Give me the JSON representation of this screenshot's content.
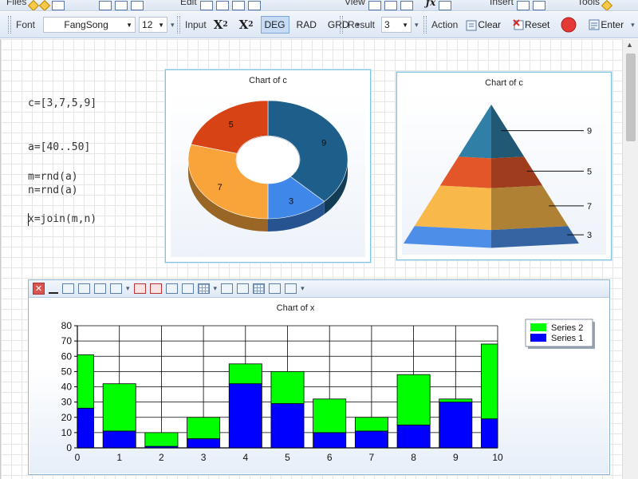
{
  "toolbar_top": {
    "files_label": "Files",
    "edit_label": "Edit",
    "view_label": "View",
    "insert_label": "Insert",
    "tools_label": "Tools"
  },
  "toolbar": {
    "font_label": "Font",
    "font_value": "FangSong",
    "size_value": "12",
    "input_label": "Input",
    "deg_label": "DEG",
    "rad_label": "RAD",
    "grd_label": "GRD",
    "result_label": "Result",
    "result_value": "3",
    "action_label": "Action",
    "clear_label": "Clear",
    "reset_label": "Reset",
    "enter_label": "Enter"
  },
  "code": {
    "line1": "c=[3,7,5,9]",
    "line2": "a=[40..50]",
    "line3": "m=rnd(a)",
    "line4": "n=rnd(a)",
    "line5": "x=join(m,n)"
  },
  "colors": {
    "toolbar_bg": "#dde7f4",
    "panel_border": "#7fc3df",
    "deg_active": "#c7dcf4",
    "series1": "#0000ff",
    "series2": "#00ff00",
    "donut_blue": "#1d5f8a",
    "donut_lightblue": "#3f87e8",
    "donut_orange": "#f9a43b",
    "donut_red": "#d84315"
  },
  "chart_data": [
    {
      "type": "pie",
      "title": "Chart of c",
      "style": "donut-3d",
      "categories": [
        "9",
        "3",
        "7",
        "5"
      ],
      "values": [
        9,
        3,
        7,
        5
      ],
      "colors": [
        "#1d5f8a",
        "#3f87e8",
        "#f9a43b",
        "#d84315"
      ]
    },
    {
      "type": "pyramid",
      "title": "Chart of c",
      "labels": [
        "9",
        "5",
        "7",
        "3"
      ],
      "values": [
        9,
        5,
        7,
        3
      ],
      "colors": [
        "#2f7fa6",
        "#e2562a",
        "#f9b84a",
        "#4d8ee8"
      ]
    },
    {
      "type": "bar",
      "stacked": true,
      "title": "Chart of x",
      "x": [
        0,
        1,
        2,
        3,
        4,
        5,
        6,
        7,
        8,
        9,
        10
      ],
      "xlim": [
        0,
        10
      ],
      "ylim": [
        0,
        80
      ],
      "yticks": [
        0,
        10,
        20,
        30,
        40,
        50,
        60,
        70,
        80
      ],
      "grid": true,
      "legend_position": "top-right",
      "series": [
        {
          "name": "Series 1",
          "color": "#0000ff",
          "values": [
            26,
            11,
            1,
            6,
            42,
            29,
            10,
            11,
            15,
            30,
            19
          ]
        },
        {
          "name": "Series 2",
          "color": "#00ff00",
          "values": [
            35,
            31,
            9,
            14,
            13,
            21,
            22,
            9,
            33,
            2,
            49
          ]
        }
      ]
    }
  ]
}
